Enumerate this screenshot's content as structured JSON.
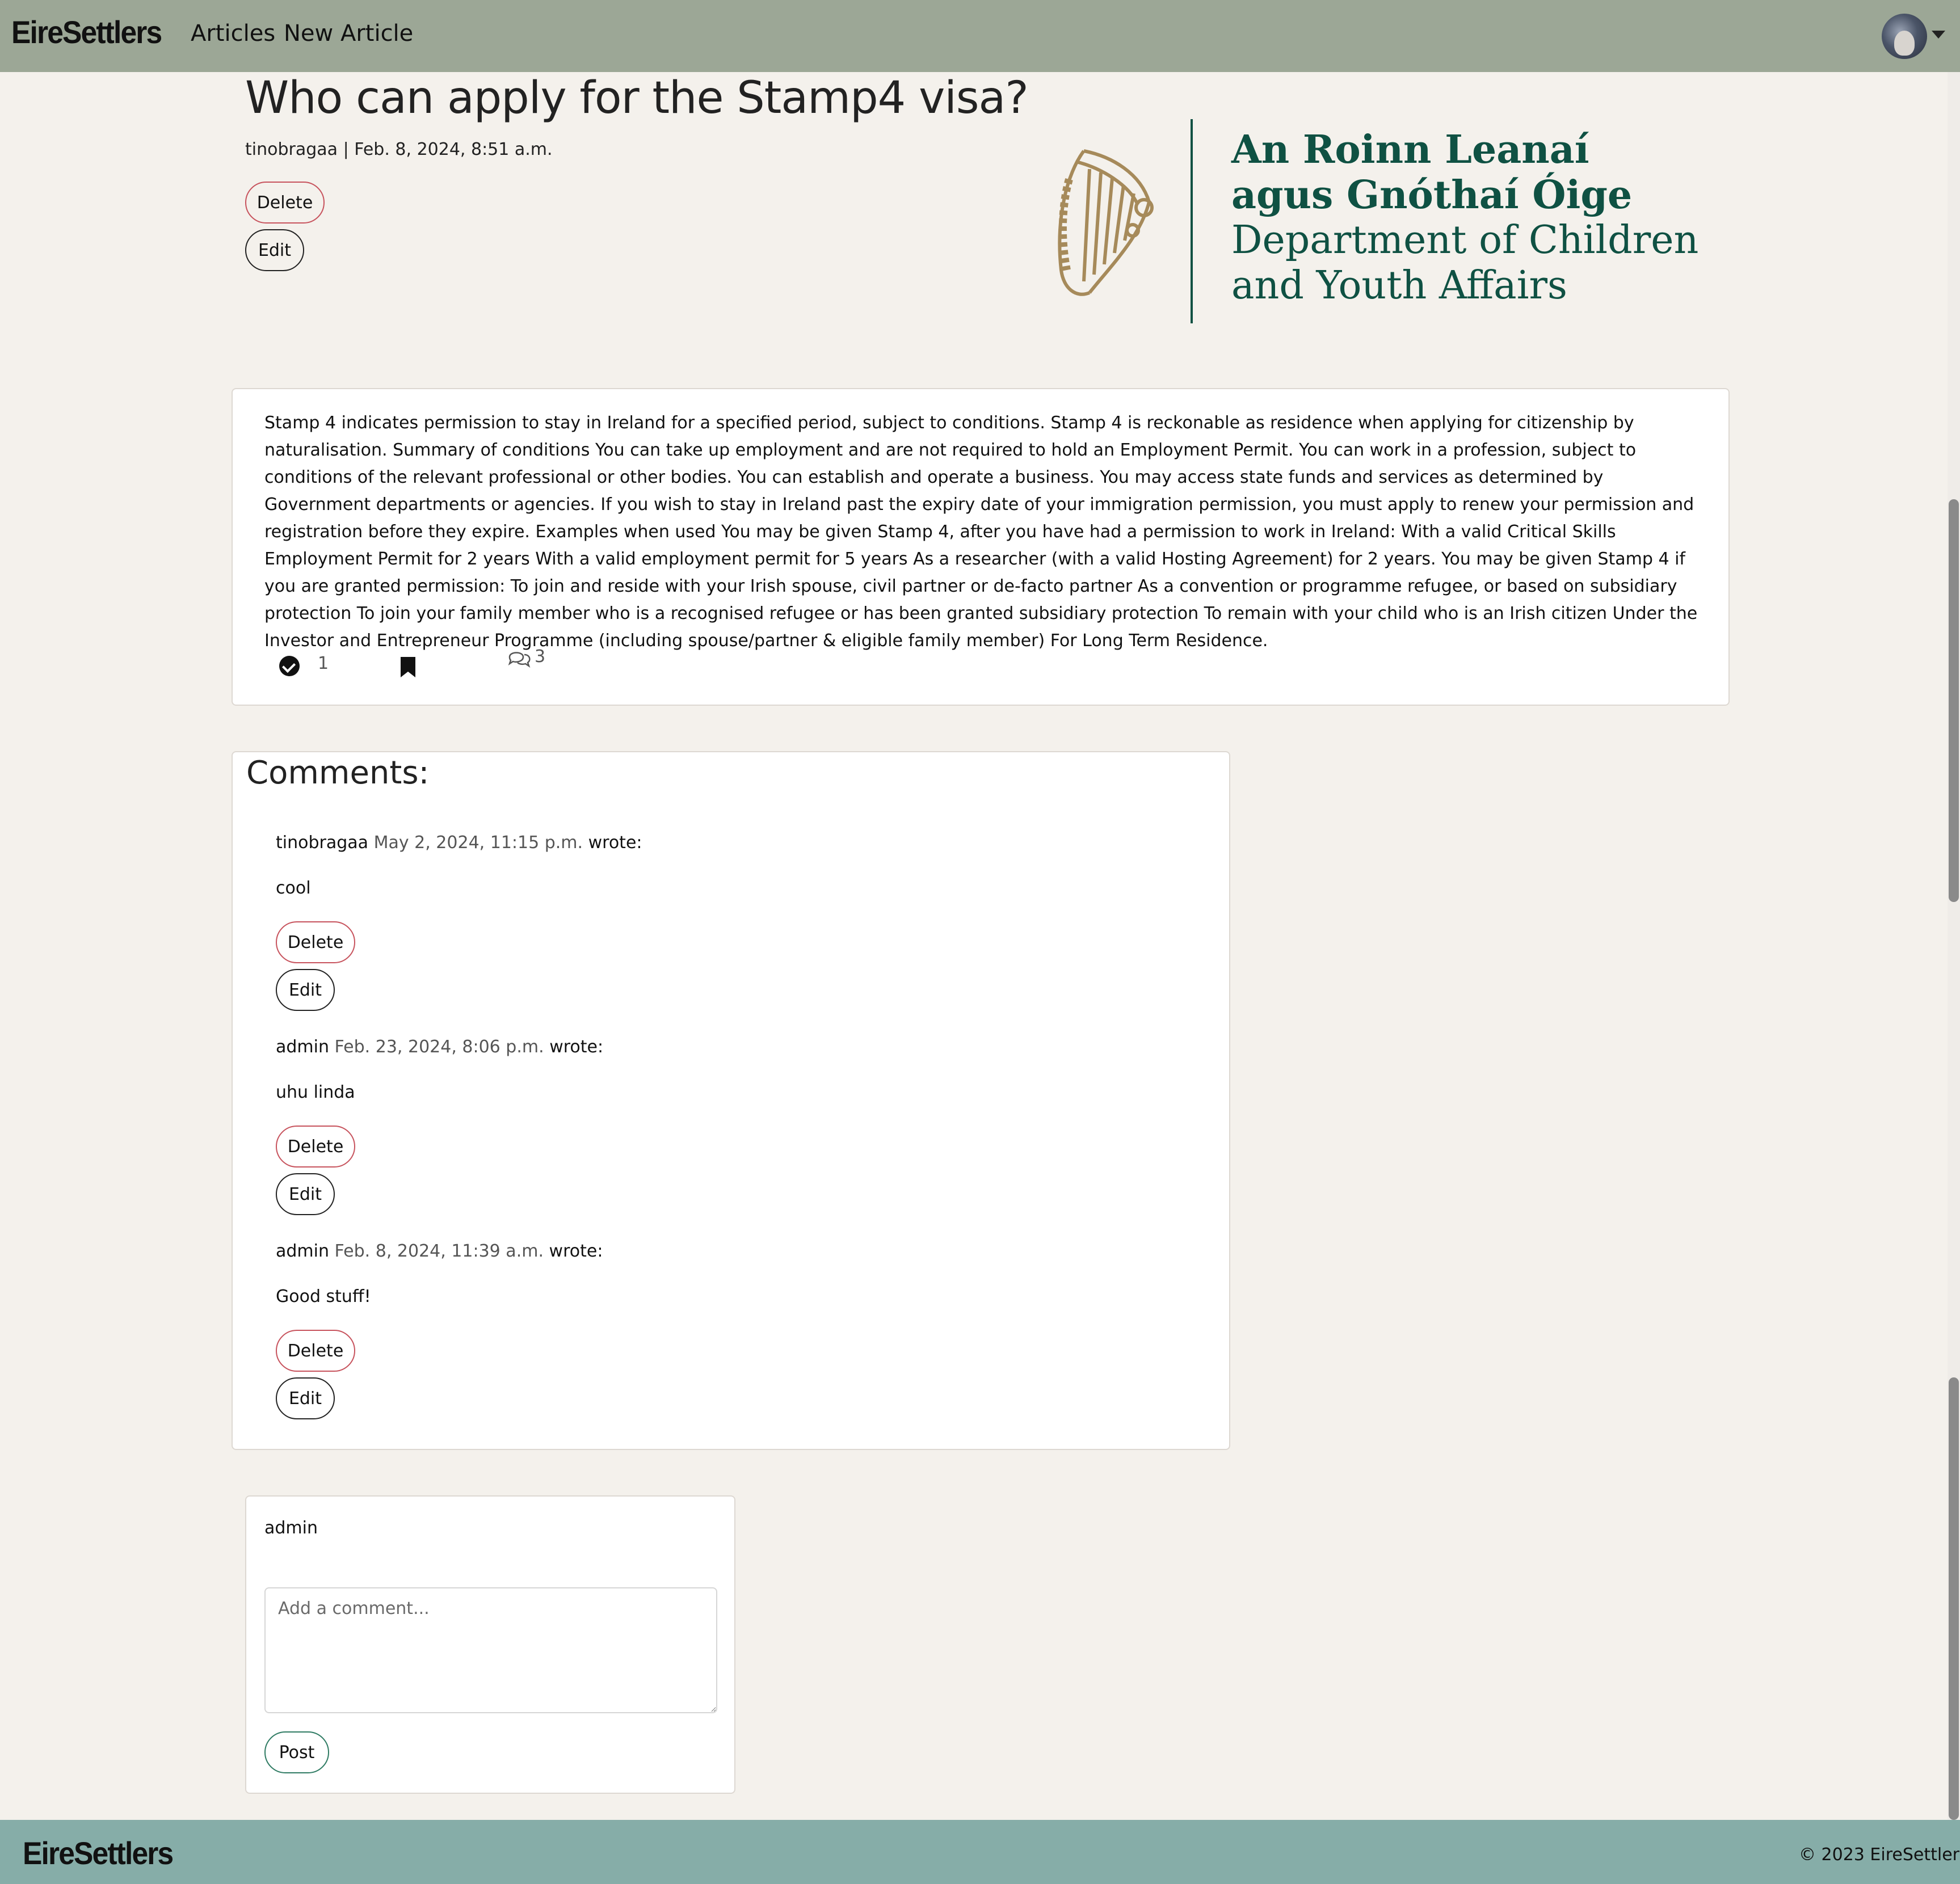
{
  "nav": {
    "brand": "EireSettlers",
    "links": [
      "Articles",
      "New Article"
    ]
  },
  "article": {
    "title": "Who can apply for the Stamp4 visa?",
    "meta": "tinobragaa | Feb. 8, 2024, 8:51 a.m.",
    "delete_label": "Delete",
    "edit_label": "Edit",
    "body": "Stamp 4 indicates permission to stay in Ireland for a specified period, subject to conditions. Stamp 4 is reckonable as residence when applying for citizenship by naturalisation. Summary of conditions You can take up employment and are not required to hold an Employment Permit. You can work in a profession, subject to conditions of the relevant professional or other bodies. You can establish and operate a business. You may access state funds and services as determined by Government departments or agencies. If you wish to stay in Ireland past the expiry date of your immigration permission, you must apply to renew your permission and registration before they expire. Examples when used You may be given Stamp 4, after you have had a permission to work in Ireland: With a valid Critical Skills Employment Permit for 2 years With a valid employment permit for 5 years As a researcher (with a valid Hosting Agreement) for 2 years. You may be given Stamp 4 if you are granted permission: To join and reside with your Irish spouse, civil partner or de-facto partner As a convention or programme refugee, or based on subsidiary protection To join your family member who is a recognised refugee or has been granted subsidiary protection To remain with your child who is an Irish citizen Under the Investor and Entrepreneur Programme (including spouse/partner & eligible family member) For Long Term Residence.",
    "approvals": "1",
    "comment_count": "3",
    "icons": [
      "check-circle-icon",
      "bookmark-icon",
      "comments-icon"
    ]
  },
  "logo": {
    "lines": [
      "An Roinn Leanaí",
      "agus Gnóthaí Óige",
      "Department of Children",
      "and Youth Affairs"
    ],
    "color": "#0f5143",
    "harp_color": "#a68a5a"
  },
  "comments": {
    "title": "Comments:",
    "items": [
      {
        "author": "tinobragaa",
        "date": "May 2, 2024, 11:15 p.m.",
        "wrote": "wrote:",
        "text": "cool",
        "delete_label": "Delete",
        "edit_label": "Edit"
      },
      {
        "author": "admin",
        "date": "Feb. 23, 2024, 8:06 p.m.",
        "wrote": "wrote:",
        "text": "uhu linda",
        "delete_label": "Delete",
        "edit_label": "Edit"
      },
      {
        "author": "admin",
        "date": "Feb. 8, 2024, 11:39 a.m.",
        "wrote": "wrote:",
        "text": "Good stuff!",
        "delete_label": "Delete",
        "edit_label": "Edit"
      }
    ]
  },
  "form": {
    "user": "admin",
    "placeholder": "Add a comment...",
    "post_label": "Post"
  },
  "footer": {
    "brand": "EireSettlers",
    "copyright": "© 2023 EireSettlers"
  },
  "colors": {
    "navbar": "#9ca796",
    "footer": "#86ada8",
    "delete_border": "#c7535d",
    "post_border": "#2f7b63"
  }
}
